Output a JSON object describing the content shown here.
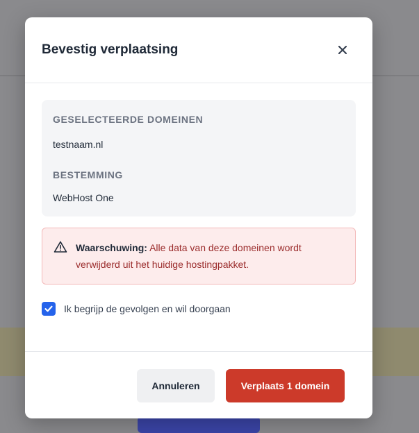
{
  "modal": {
    "title": "Bevestig verplaatsing",
    "close_icon": "close-icon"
  },
  "selection": {
    "domains_heading": "GESELECTEERDE DOMEINEN",
    "domains_value": "testnaam.nl",
    "destination_heading": "BESTEMMING",
    "destination_value": "WebHost One"
  },
  "warning": {
    "icon": "warning-triangle-icon",
    "label": "Waarschuwing:",
    "message": "Alle data van deze domeinen wordt verwijderd uit het huidige hostingpakket."
  },
  "confirm": {
    "checked": true,
    "label": "Ik begrijp de gevolgen en wil doorgaan"
  },
  "footer": {
    "cancel_label": "Annuleren",
    "confirm_label": "Verplaats 1 domein"
  },
  "colors": {
    "accent_blue": "#2563eb",
    "danger_red": "#cc3a2a",
    "warning_bg": "#fdecec"
  }
}
